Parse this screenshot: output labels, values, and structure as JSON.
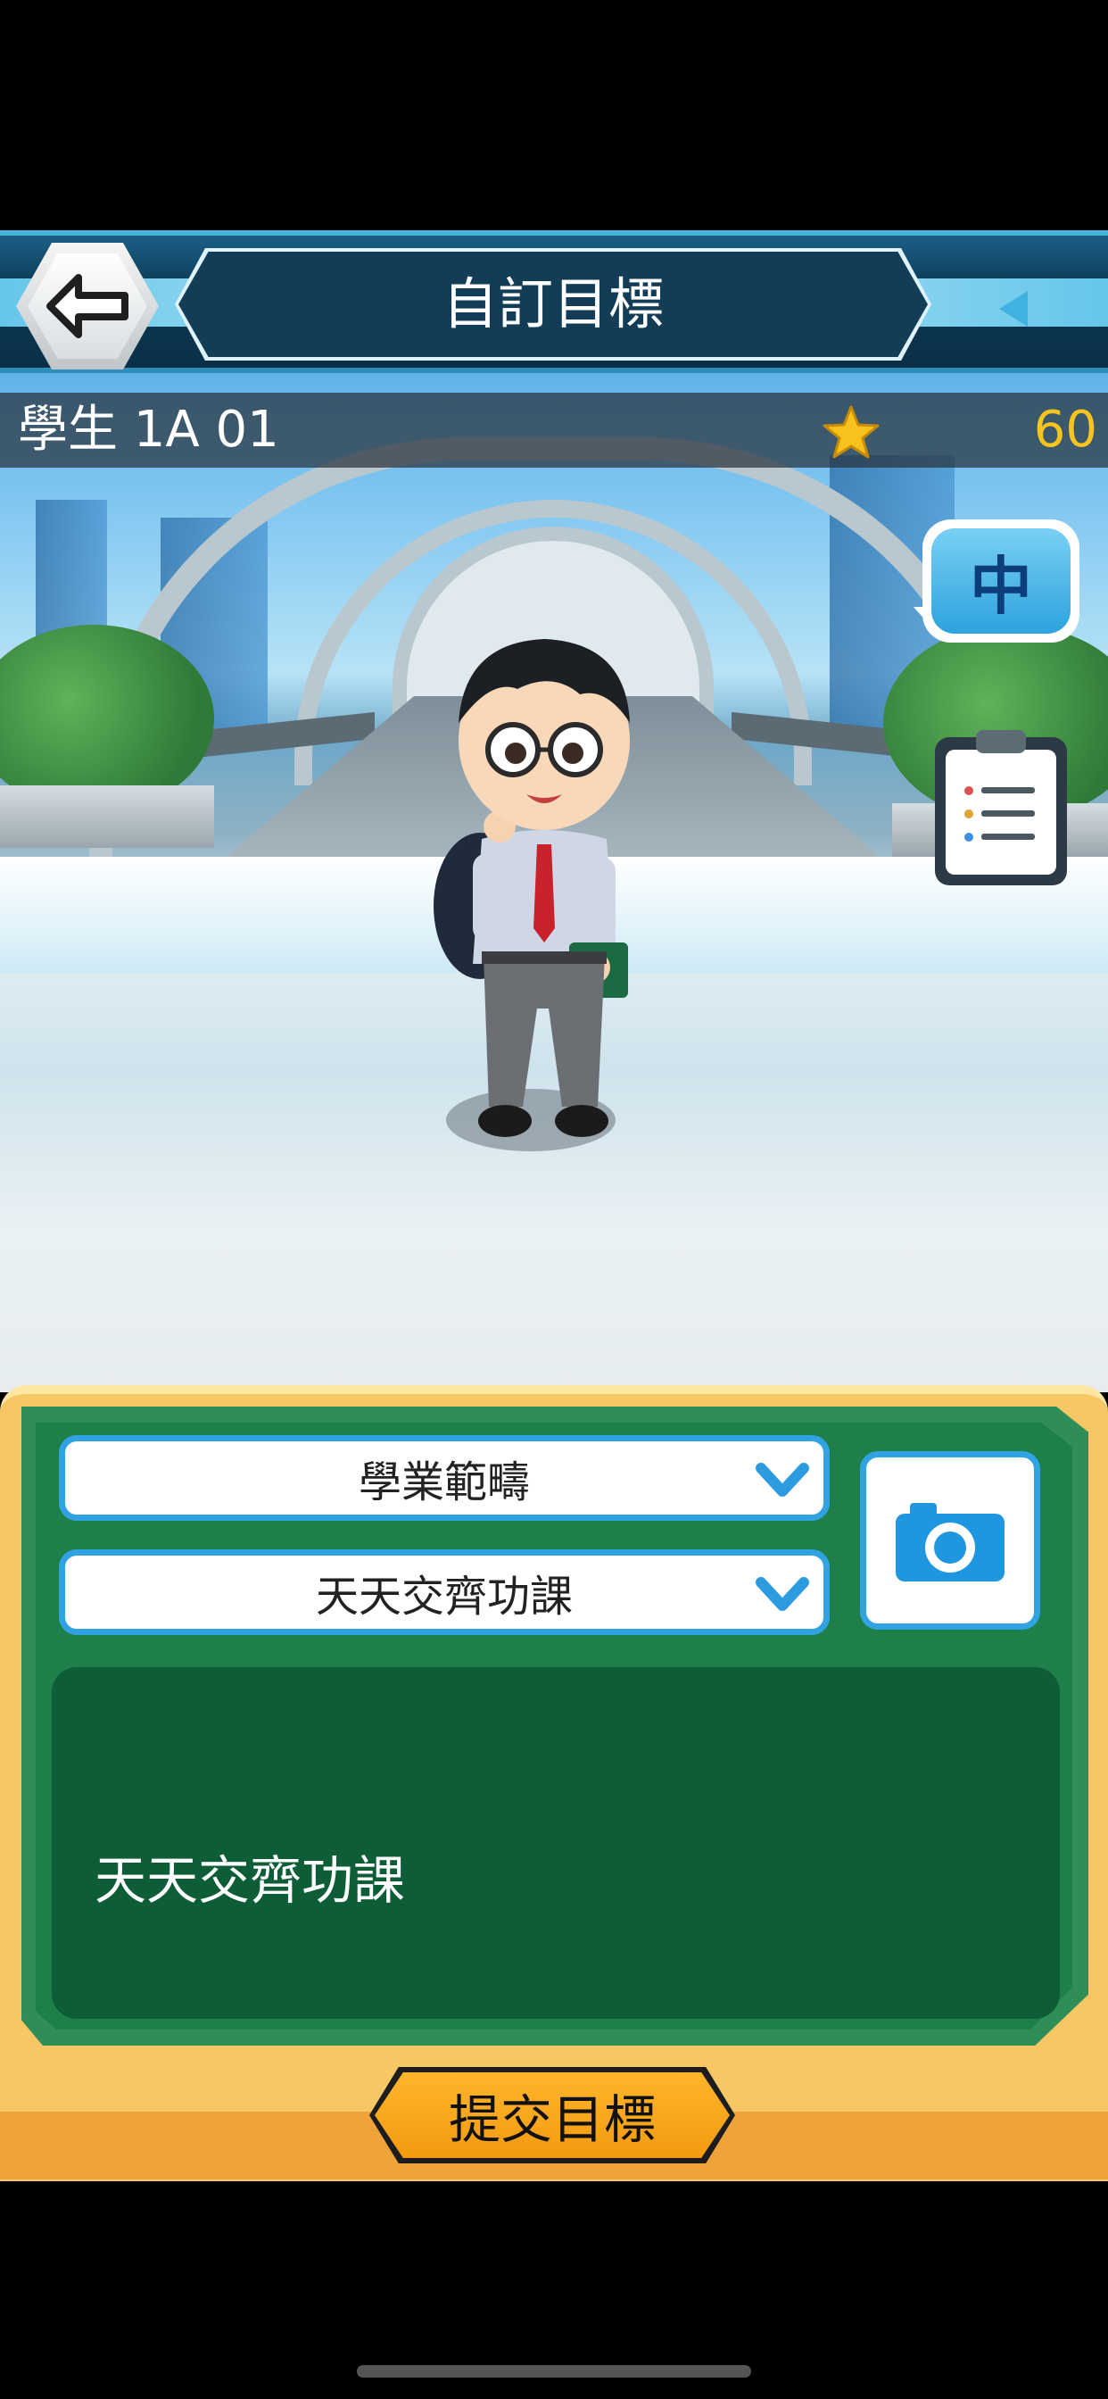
{
  "header": {
    "title": "自訂目標",
    "back_icon": "back-arrow-icon",
    "side_arrow_icon": "triangle-left-icon"
  },
  "status": {
    "student_name": "學生 1A 01",
    "star_icon": "star-icon",
    "stars": "60"
  },
  "side_buttons": {
    "language_label": "中",
    "checklist_icon": "clipboard-icon"
  },
  "form": {
    "category_select": "學業範疇",
    "goal_select": "天天交齊功課",
    "camera_icon": "camera-icon",
    "goal_text": "天天交齊功課",
    "submit_label": "提交目標"
  },
  "colors": {
    "accent_blue": "#31a3e3",
    "board_green": "#1f7f4b",
    "panel_yellow": "#f7c765",
    "submit_orange": "#f39a10",
    "star_gold": "#f6c51d"
  }
}
